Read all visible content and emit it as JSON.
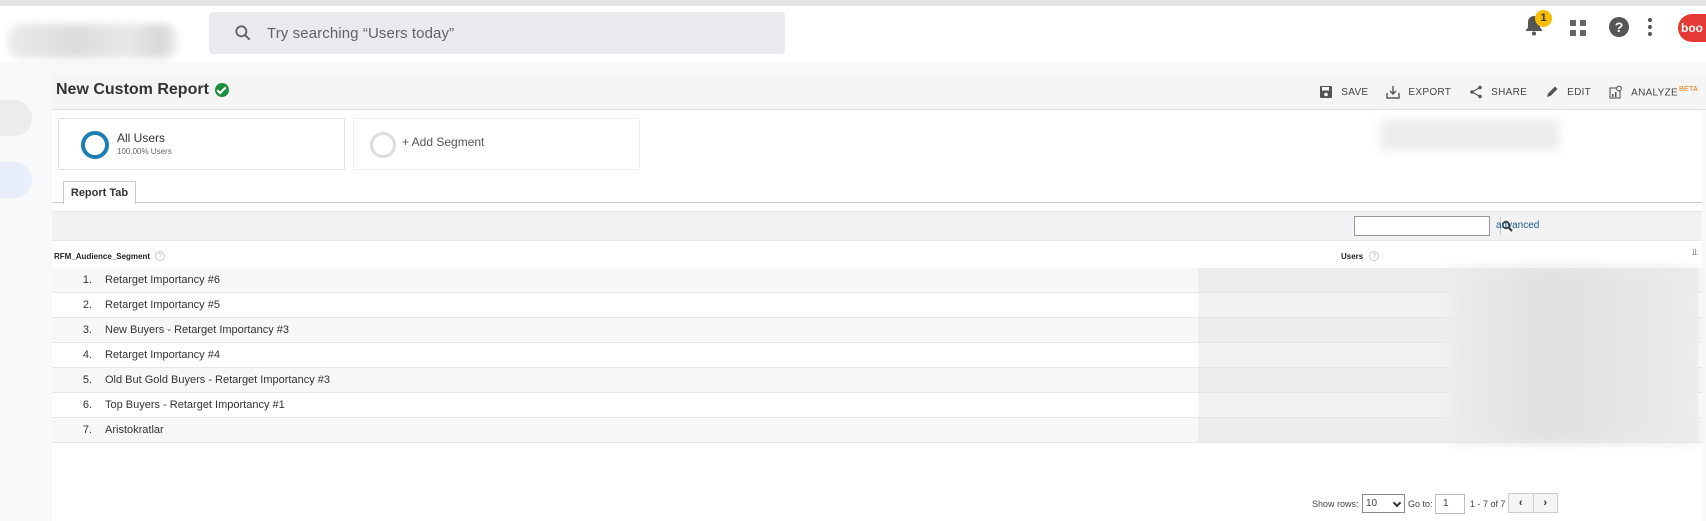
{
  "topbar": {
    "search_placeholder": "Try searching “Users today”",
    "notification_count": "1",
    "help_glyph": "?",
    "avatar_text": "boo",
    "icons": [
      "search-icon",
      "bell-icon",
      "apps-grid-icon",
      "help-icon",
      "more-vert-icon"
    ]
  },
  "report": {
    "title": "New Custom Report",
    "verified_icon": "check-circle-icon",
    "actions": [
      {
        "label": "SAVE",
        "icon": "save-icon"
      },
      {
        "label": "EXPORT",
        "icon": "export-icon"
      },
      {
        "label": "SHARE",
        "icon": "share-icon"
      },
      {
        "label": "EDIT",
        "icon": "pencil-icon"
      },
      {
        "label": "ANALYZE",
        "icon": "analyze-icon",
        "badge": "BETA"
      }
    ]
  },
  "segments": {
    "active": {
      "name": "All Users",
      "sub": "100.00% Users"
    },
    "add_label": "+ Add Segment"
  },
  "tabs": [
    {
      "label": "Report Tab",
      "active": true
    }
  ],
  "filter": {
    "value": "",
    "advanced_label": "advanced"
  },
  "table": {
    "columns": {
      "dimension": "RFM_Audience_Segment",
      "metric": "Users"
    },
    "help_glyph": "?",
    "sort_glyph": "⫫",
    "rows": [
      {
        "num": "1.",
        "name": "Retarget Importancy #6"
      },
      {
        "num": "2.",
        "name": "Retarget Importancy #5"
      },
      {
        "num": "3.",
        "name": "New Buyers - Retarget Importancy #3"
      },
      {
        "num": "4.",
        "name": "Retarget Importancy #4"
      },
      {
        "num": "5.",
        "name": "Old But Gold Buyers - Retarget Importancy #3"
      },
      {
        "num": "6.",
        "name": "Top Buyers - Retarget Importancy #1"
      },
      {
        "num": "7.",
        "name": "Aristokratlar"
      }
    ]
  },
  "pagination": {
    "show_rows_label": "Show rows:",
    "show_rows_value": "10",
    "goto_label": "Go to:",
    "goto_value": "1",
    "range": "1 - 7 of 7",
    "prev": "‹",
    "next": "›"
  },
  "colors": {
    "accent_ring": "#1a7fb0",
    "verified": "#1e8e3e",
    "badge": "#fbbc04",
    "avatar": "#e53935",
    "beta": "#e8710a",
    "link": "#1f5a8c"
  }
}
